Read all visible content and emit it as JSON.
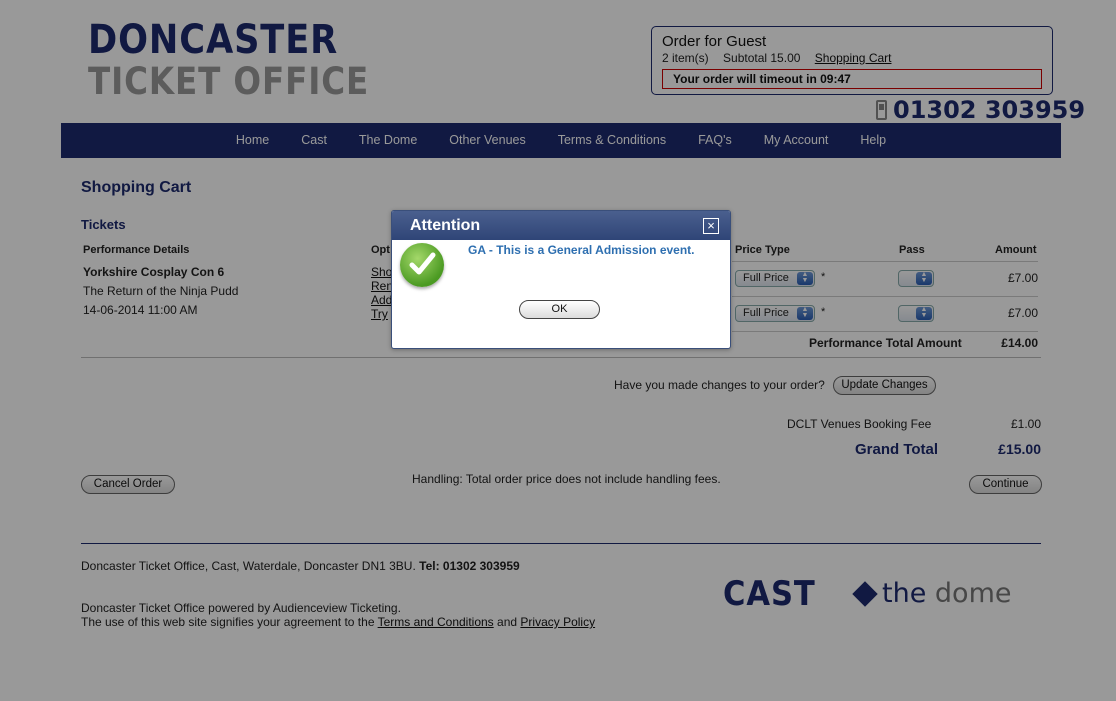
{
  "brand": {
    "line1": "DONCASTER",
    "line2": "TICKET OFFICE",
    "phone": "01302 303959"
  },
  "order_box": {
    "title": "Order for Guest",
    "items": "2 item(s)",
    "subtotal": "Subtotal 15.00",
    "cart_link": "Shopping Cart",
    "timeout": "Your order will timeout in 09:47"
  },
  "nav": [
    "Home",
    "Cast",
    "The Dome",
    "Other Venues",
    "Terms & Conditions",
    "FAQ's",
    "My Account",
    "Help"
  ],
  "cart": {
    "title": "Shopping Cart",
    "section": "Tickets",
    "headers": {
      "performance": "Performance Details",
      "options": "Opt",
      "price_type": "Price Type",
      "pass": "Pass",
      "amount": "Amount"
    },
    "performance": {
      "name": "Yorkshire Cosplay Con 6",
      "subtitle": "The Return of the Ninja Pudd",
      "datetime": "14-06-2014 11:00 AM"
    },
    "option_links": [
      "Sho",
      "Ren",
      "Add",
      "Try"
    ],
    "rows": [
      {
        "price_type": "Full Price",
        "marker": "*",
        "amount": "£7.00"
      },
      {
        "price_type": "Full Price",
        "marker": "*",
        "amount": "£7.00"
      }
    ],
    "performance_total_label": "Performance Total Amount",
    "performance_total": "£14.00",
    "changes_question": "Have you made changes to your order?",
    "update_button": "Update Changes",
    "fee_label": "DCLT Venues Booking Fee",
    "fee": "£1.00",
    "grand_total_label": "Grand Total",
    "grand_total": "£15.00",
    "cancel_button": "Cancel Order",
    "handling_note": "Handling: Total order price does not include handling fees.",
    "continue_button": "Continue"
  },
  "footer": {
    "address": "Doncaster Ticket Office, Cast, Waterdale, Doncaster DN1 3BU.",
    "tel_label": "Tel: 01302 303959",
    "powered": "Doncaster Ticket Office powered by Audienceview Ticketing.",
    "agree_prefix": "The use of this web site signifies your agreement to the",
    "terms_link": "Terms and Conditions",
    "and": "and",
    "privacy_link": "Privacy Policy",
    "cast_logo": "CAST",
    "dome_logo_a": "the",
    "dome_logo_b": "dome"
  },
  "modal": {
    "title": "Attention",
    "message": "GA - This is a General Admission event.",
    "ok": "OK",
    "close_glyph": "×"
  },
  "icons": {
    "close": "close-icon",
    "success": "checkmark-icon",
    "phone": "phone-icon",
    "dropdown": "chevron-updown-icon"
  },
  "colors": {
    "navy": "#1d2a6e",
    "alert_red": "#cc0000",
    "modal_text": "#2e6fb0",
    "success_green": "#4b9a22"
  }
}
